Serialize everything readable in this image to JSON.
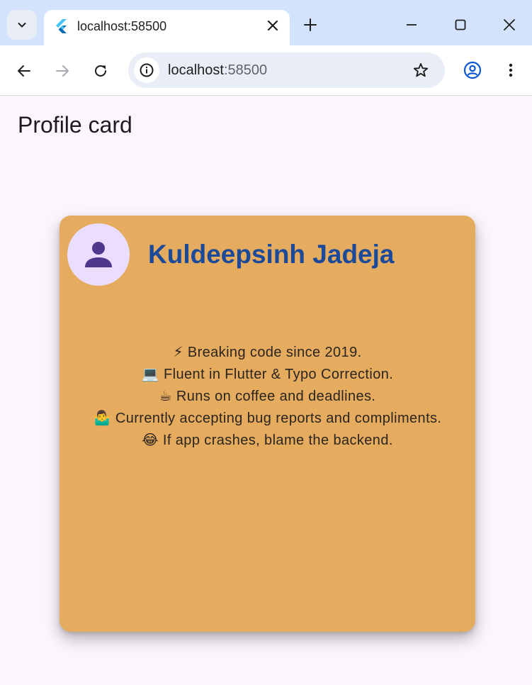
{
  "browser": {
    "tab_title": "localhost:58500",
    "url_host": "localhost",
    "url_port": ":58500"
  },
  "app": {
    "title": "Profile card",
    "card": {
      "name": "Kuldeepsinh Jadeja",
      "avatar_icon": "person-icon",
      "background_color": "#e5ab5e",
      "name_color": "#1c4a9a",
      "bio_lines": [
        "⚡ Breaking code since 2019.",
        "💻 Fluent in Flutter & Typo Correction.",
        "☕ Runs on coffee and deadlines.",
        "🤷‍♂️ Currently accepting bug reports and compliments.",
        "😂 If app crashes, blame the backend."
      ]
    }
  }
}
